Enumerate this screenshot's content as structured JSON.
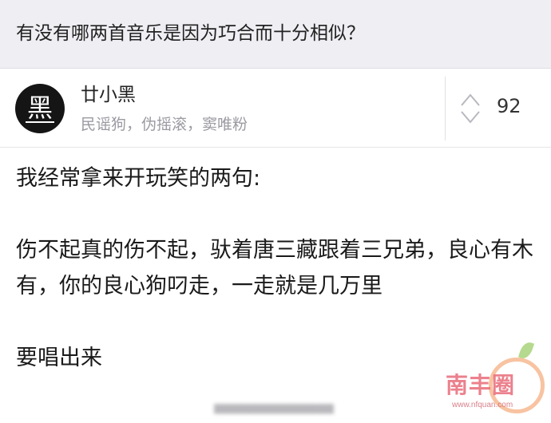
{
  "question": {
    "title": "有没有哪两首音乐是因为巧合而十分相似？"
  },
  "author": {
    "avatar_char": "黑",
    "name": "廿小黑",
    "bio": "民谣狗，伪摇滚，窦唯粉"
  },
  "vote": {
    "count": "92",
    "icon": "up-down-vote-arrows-icon"
  },
  "answer": {
    "paragraphs": [
      "我经常拿来开玩笑的两句:",
      "伤不起真的伤不起，驮着唐三藏跟着三兄弟，良心有木有，你的良心狗叼走，一走就是几万里",
      "要唱出来"
    ]
  },
  "watermark": {
    "text": "南丰圈",
    "url": "www.nfquan.com",
    "accent_color": "#e86c7a"
  },
  "colors": {
    "question_bar_bg": "#eeeef3",
    "muted_text": "#9a9aa2"
  }
}
